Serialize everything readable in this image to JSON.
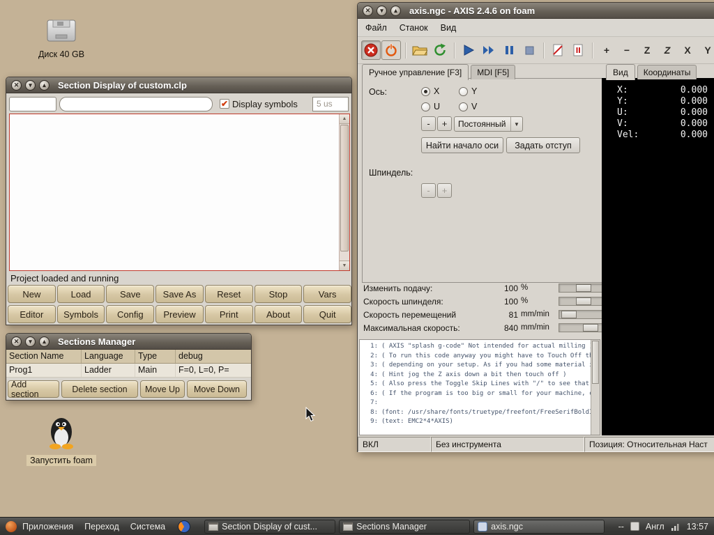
{
  "desktop": {
    "disk_label": "Диск 40 GB",
    "launcher_label": "Запустить foam"
  },
  "chrome": {
    "close": "✕",
    "minimize": "▾",
    "maximize": "▴"
  },
  "icons": {
    "check": "✔",
    "dropdown": "▼",
    "scroll_up": "▲",
    "scroll_down": "▼"
  },
  "section_display": {
    "title": "Section Display of custom.clp",
    "symbols_checkbox_label": "Display symbols",
    "refresh_value": "5 us",
    "status": "Project loaded and running",
    "buttons_row1": [
      "New",
      "Load",
      "Save",
      "Save As",
      "Reset",
      "Stop",
      "Vars"
    ],
    "buttons_row2": [
      "Editor",
      "Symbols",
      "Config",
      "Preview",
      "Print",
      "About",
      "Quit"
    ]
  },
  "sections_manager": {
    "title": "Sections Manager",
    "columns": [
      "Section Name",
      "Language",
      "Type",
      "debug"
    ],
    "row": [
      "Prog1",
      "Ladder",
      "Main",
      "F=0, L=0, P="
    ],
    "buttons": [
      "Add section",
      "Delete section",
      "Move Up",
      "Move Down"
    ]
  },
  "axis": {
    "title": "axis.ngc - AXIS 2.4.6 on foam",
    "menus": [
      "Файл",
      "Станок",
      "Вид"
    ],
    "toolbar": {
      "zoom_in": "+",
      "zoom_out": "−",
      "letter_z": "Z",
      "letter_z2": "Z",
      "letter_x": "X",
      "letter_y": "Y"
    },
    "tabs": [
      "Ручное управление [F3]",
      "MDI [F5]"
    ],
    "manual": {
      "axis_label": "Ось:",
      "axes": [
        "X",
        "Y",
        "U",
        "V"
      ],
      "selected_axis": "X",
      "jog_minus": "-",
      "jog_plus": "+",
      "jog_mode": "Постоянный",
      "home_button": "Найти начало оси",
      "touchoff_button": "Задать отступ",
      "spindle_label": "Шпиндель:",
      "spindle_minus": "-",
      "spindle_plus": "+"
    },
    "view_tabs": [
      "Вид",
      "Координаты"
    ],
    "dro": [
      {
        "label": "X:",
        "value": "0.000"
      },
      {
        "label": "Y:",
        "value": "0.000"
      },
      {
        "label": "U:",
        "value": "0.000"
      },
      {
        "label": "V:",
        "value": "0.000"
      },
      {
        "label": "Vel:",
        "value": "0.000"
      }
    ],
    "sliders": [
      {
        "label": "Изменить подачу:",
        "value": "100",
        "unit": "%"
      },
      {
        "label": "Скорость шпинделя:",
        "value": "100",
        "unit": "%"
      },
      {
        "label": "Скорость перемещений",
        "value": "81",
        "unit": "mm/min"
      },
      {
        "label": "Максимальная скорость:",
        "value": "840",
        "unit": "mm/min"
      }
    ],
    "gcode": [
      {
        "n": "1:",
        "text": "( AXIS \"splash g-code\" Not intended for actual milling )"
      },
      {
        "n": "2:",
        "text": "( To run this code anyway you might have to Touch Off the Z axis)"
      },
      {
        "n": "3:",
        "text": "( depending on your setup. As if you had some material in your v"
      },
      {
        "n": "4:",
        "text": "( Hint jog the Z axis down a bit then touch off )"
      },
      {
        "n": "5:",
        "text": "( Also press the Toggle Skip Lines with \"/\" to see that part )"
      },
      {
        "n": "6:",
        "text": "( If the program is too big or small for your machine, change the"
      },
      {
        "n": "7:",
        "text": ""
      },
      {
        "n": "8:",
        "text": "(font: /usr/share/fonts/truetype/freefont/FreeSerifBoldItalic.tt"
      },
      {
        "n": "9:",
        "text": "(text: EMC2*4*AXIS)"
      }
    ],
    "status": [
      "ВКЛ",
      "Без инструмента",
      "Позиция: Относительная Наст"
    ]
  },
  "taskbar": {
    "menus": [
      "Приложения",
      "Переход",
      "Система"
    ],
    "tasks": [
      "Section Display of cust...",
      "Sections Manager",
      "axis.ngc"
    ],
    "tray": {
      "dashes": "--",
      "layout": "Англ",
      "clock": "13:57"
    }
  }
}
